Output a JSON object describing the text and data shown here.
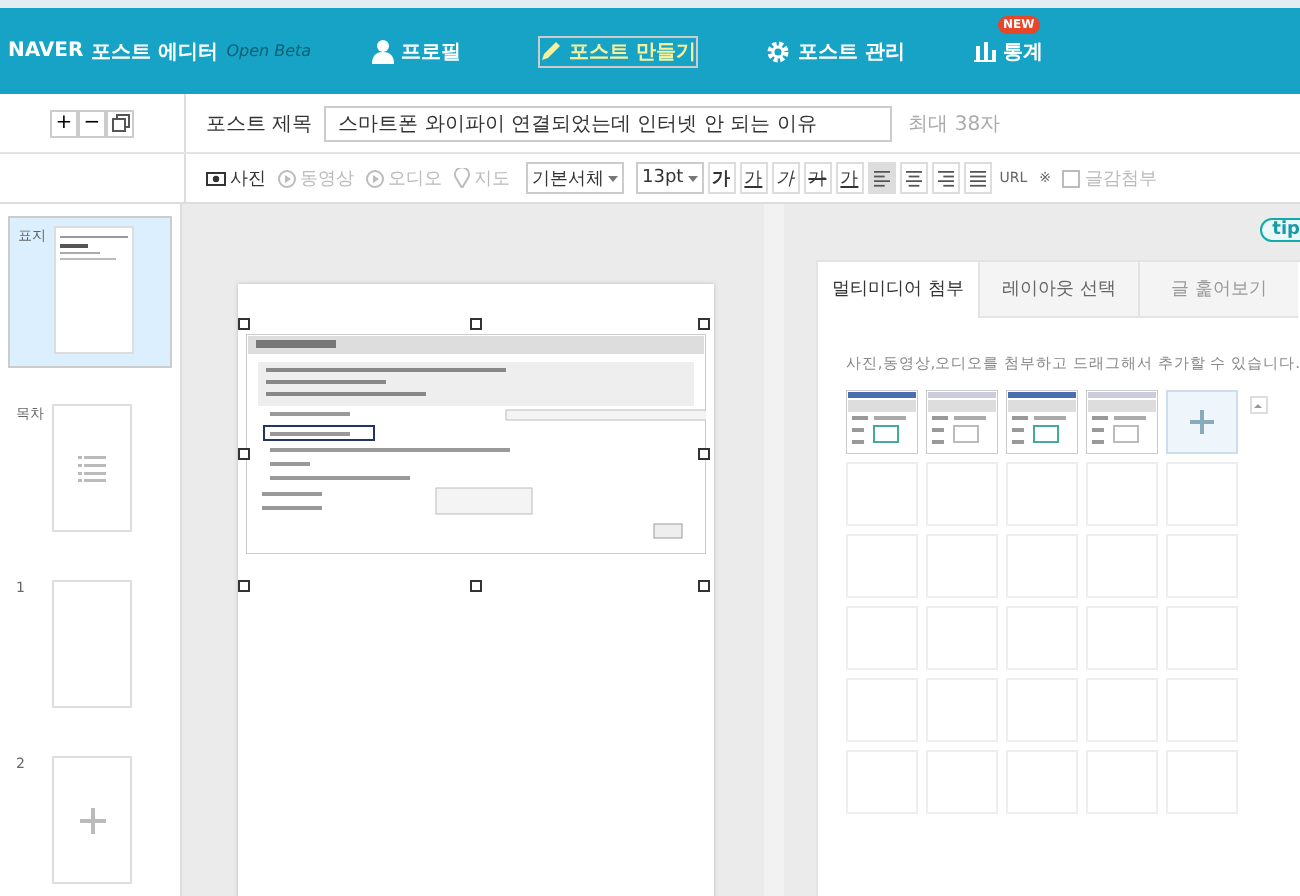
{
  "header": {
    "logo": "NAVER",
    "app_name": "포스트 에디터",
    "badge": "Open Beta",
    "nav": [
      {
        "label": "프로필",
        "selected": false,
        "new": false
      },
      {
        "label": "포스트 만들기",
        "selected": true,
        "new": false
      },
      {
        "label": "포스트 관리",
        "selected": false,
        "new": false
      },
      {
        "label": "통계",
        "selected": false,
        "new": true,
        "new_label": "NEW"
      }
    ]
  },
  "page_tools": [
    "+",
    "−"
  ],
  "title_row": {
    "label": "포스트 제목",
    "value": "스마트폰 와이파이 연결되었는데 인터넷 안 되는 이유",
    "hint": "최대 38자"
  },
  "toolbar": [
    {
      "kind": "media",
      "label": "사진",
      "disabled": false
    },
    {
      "kind": "media",
      "label": "동영상",
      "disabled": true
    },
    {
      "kind": "media",
      "label": "오디오",
      "disabled": true
    },
    {
      "kind": "media",
      "label": "지도",
      "disabled": true
    },
    {
      "kind": "select",
      "label": "기본서체"
    },
    {
      "kind": "select",
      "label": "13pt"
    },
    {
      "kind": "style",
      "label": "가"
    },
    {
      "kind": "style",
      "label": "가"
    },
    {
      "kind": "style",
      "label": "가"
    },
    {
      "kind": "style",
      "label": "가"
    },
    {
      "kind": "style",
      "label": "가"
    },
    {
      "kind": "align",
      "selected": true
    },
    {
      "kind": "align",
      "selected": false
    },
    {
      "kind": "align",
      "selected": false
    },
    {
      "kind": "align",
      "selected": false
    },
    {
      "kind": "text",
      "label": "URL"
    },
    {
      "kind": "text",
      "label": "※"
    },
    {
      "kind": "media",
      "label": "글감첨부",
      "disabled": true
    }
  ],
  "pages": [
    {
      "label": "표지",
      "selected": true
    },
    {
      "label": "목차",
      "selected": false
    },
    {
      "label": "1",
      "selected": false
    },
    {
      "label": "2",
      "selected": false
    }
  ],
  "tip": "tip",
  "panel": {
    "tabs": [
      {
        "label": "멀티미디어 첨부",
        "selected": true,
        "disabled": false
      },
      {
        "label": "레이아웃 선택",
        "selected": false,
        "disabled": false
      },
      {
        "label": "글 훑어보기",
        "selected": false,
        "disabled": true
      }
    ],
    "description": "사진,동영상,오디오를 첨부하고 드래그해서 추가할 수 있습니다.",
    "slots": [
      {
        "kind": "picture"
      },
      {
        "kind": "picture"
      },
      {
        "kind": "picture"
      },
      {
        "kind": "picture"
      },
      {
        "kind": "add"
      }
    ]
  }
}
